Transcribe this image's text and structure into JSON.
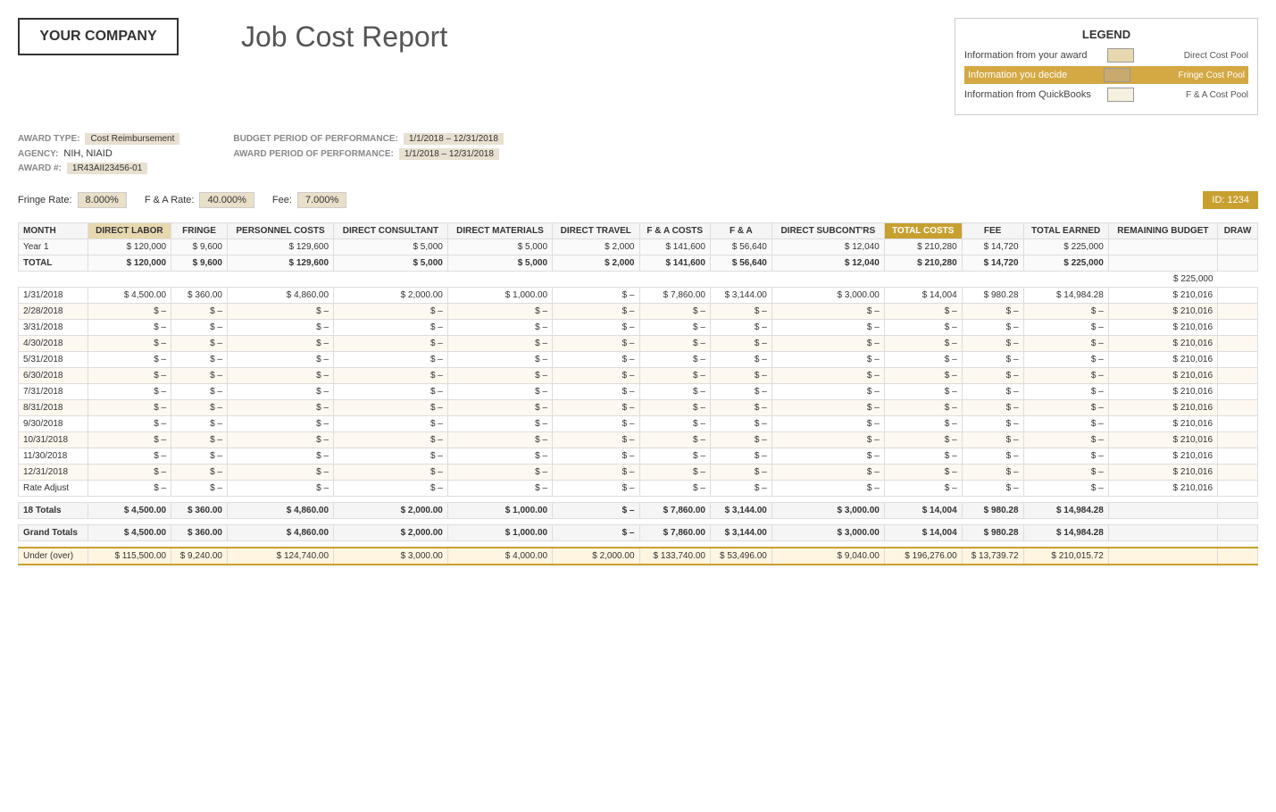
{
  "company": {
    "name": "YOUR COMPANY"
  },
  "title": "Job Cost Report",
  "legend": {
    "title": "LEGEND",
    "rows": [
      {
        "label": "Information from your award",
        "style": "plain",
        "swatch": "tan",
        "desc": "Direct Cost Pool"
      },
      {
        "label": "Information you decide",
        "style": "orange",
        "swatch": "orange",
        "desc": "Fringe Cost Pool"
      },
      {
        "label": "Information from QuickBooks",
        "style": "plain",
        "swatch": "light",
        "desc": "F & A Cost Pool"
      }
    ]
  },
  "award": {
    "type_label": "AWARD TYPE:",
    "type_value": "Cost Reimbursement",
    "agency_label": "AGENCY:",
    "agency_value": "NIH, NIAID",
    "number_label": "AWARD #:",
    "number_value": "1R43AII23456-01",
    "budget_label": "BUDGET PERIOD OF PERFORMANCE:",
    "budget_value": "1/1/2018 – 12/31/2018",
    "award_label": "AWARD PERIOD OF PERFORMANCE:",
    "award_value": "1/1/2018 – 12/31/2018"
  },
  "rates": {
    "fringe_label": "Fringe Rate:",
    "fringe_value": "8.000%",
    "fa_label": "F & A Rate:",
    "fa_value": "40.000%",
    "fee_label": "Fee:",
    "fee_value": "7.000%",
    "id_label": "ID:",
    "id_value": "1234"
  },
  "table": {
    "headers": [
      "MONTH",
      "DIRECT LABOR",
      "FRINGE",
      "PERSONNEL COSTS",
      "DIRECT CONSULTANT",
      "DIRECT MATERIALS",
      "DIRECT TRAVEL",
      "F & A COSTS",
      "F & A",
      "DIRECT SUBCONT'RS",
      "TOTAL COSTS",
      "FEE",
      "TOTAL EARNED",
      "REMAINING BUDGET",
      "DRAW"
    ],
    "year1_row": {
      "month": "Year 1",
      "direct_labor": "$ 120,000",
      "fringe": "$ 9,600",
      "personnel": "$ 129,600",
      "consultant": "$ 5,000",
      "materials": "$ 5,000",
      "travel": "$ 2,000",
      "fa_costs": "$ 141,600",
      "fa": "$ 56,640",
      "subcont": "$ 12,040",
      "total_costs": "$ 210,280",
      "fee": "$ 14,720",
      "total_earned": "$ 225,000",
      "remaining": "",
      "draw": ""
    },
    "total_row": {
      "month": "TOTAL",
      "direct_labor": "$ 120,000",
      "fringe": "$ 9,600",
      "personnel": "$ 129,600",
      "consultant": "$ 5,000",
      "materials": "$ 5,000",
      "travel": "$ 2,000",
      "fa_costs": "$ 141,600",
      "fa": "$ 56,640",
      "subcont": "$ 12,040",
      "total_costs": "$ 210,280",
      "fee": "$ 14,720",
      "total_earned": "$ 225,000",
      "remaining": "",
      "draw": ""
    },
    "spacer_225": "$ 225,000",
    "date_rows": [
      {
        "month": "1/31/2018",
        "direct_labor": "$ 4,500.00",
        "fringe": "$ 360.00",
        "personnel": "$ 4,860.00",
        "consultant": "$ 2,000.00",
        "materials": "$ 1,000.00",
        "travel": "$ –",
        "fa_costs": "$ 7,860.00",
        "fa": "$ 3,144.00",
        "subcont": "$ 3,000.00",
        "total_costs": "$ 14,004",
        "fee": "$ 980.28",
        "total_earned": "$ 14,984.28",
        "remaining": "$ 210,016",
        "draw": "",
        "alt": false
      },
      {
        "month": "2/28/2018",
        "direct_labor": "$ –",
        "fringe": "$ –",
        "personnel": "$ –",
        "consultant": "$ –",
        "materials": "$ –",
        "travel": "$ –",
        "fa_costs": "$ –",
        "fa": "$ –",
        "subcont": "$ –",
        "total_costs": "$ –",
        "fee": "$ –",
        "total_earned": "$ –",
        "remaining": "$ 210,016",
        "draw": "",
        "alt": true
      },
      {
        "month": "3/31/2018",
        "direct_labor": "$ –",
        "fringe": "$ –",
        "personnel": "$ –",
        "consultant": "$ –",
        "materials": "$ –",
        "travel": "$ –",
        "fa_costs": "$ –",
        "fa": "$ –",
        "subcont": "$ –",
        "total_costs": "$ –",
        "fee": "$ –",
        "total_earned": "$ –",
        "remaining": "$ 210,016",
        "draw": "",
        "alt": false
      },
      {
        "month": "4/30/2018",
        "direct_labor": "$ –",
        "fringe": "$ –",
        "personnel": "$ –",
        "consultant": "$ –",
        "materials": "$ –",
        "travel": "$ –",
        "fa_costs": "$ –",
        "fa": "$ –",
        "subcont": "$ –",
        "total_costs": "$ –",
        "fee": "$ –",
        "total_earned": "$ –",
        "remaining": "$ 210,016",
        "draw": "",
        "alt": true
      },
      {
        "month": "5/31/2018",
        "direct_labor": "$ –",
        "fringe": "$ –",
        "personnel": "$ –",
        "consultant": "$ –",
        "materials": "$ –",
        "travel": "$ –",
        "fa_costs": "$ –",
        "fa": "$ –",
        "subcont": "$ –",
        "total_costs": "$ –",
        "fee": "$ –",
        "total_earned": "$ –",
        "remaining": "$ 210,016",
        "draw": "",
        "alt": false
      },
      {
        "month": "6/30/2018",
        "direct_labor": "$ –",
        "fringe": "$ –",
        "personnel": "$ –",
        "consultant": "$ –",
        "materials": "$ –",
        "travel": "$ –",
        "fa_costs": "$ –",
        "fa": "$ –",
        "subcont": "$ –",
        "total_costs": "$ –",
        "fee": "$ –",
        "total_earned": "$ –",
        "remaining": "$ 210,016",
        "draw": "",
        "alt": true
      },
      {
        "month": "7/31/2018",
        "direct_labor": "$ –",
        "fringe": "$ –",
        "personnel": "$ –",
        "consultant": "$ –",
        "materials": "$ –",
        "travel": "$ –",
        "fa_costs": "$ –",
        "fa": "$ –",
        "subcont": "$ –",
        "total_costs": "$ –",
        "fee": "$ –",
        "total_earned": "$ –",
        "remaining": "$ 210,016",
        "draw": "",
        "alt": false
      },
      {
        "month": "8/31/2018",
        "direct_labor": "$ –",
        "fringe": "$ –",
        "personnel": "$ –",
        "consultant": "$ –",
        "materials": "$ –",
        "travel": "$ –",
        "fa_costs": "$ –",
        "fa": "$ –",
        "subcont": "$ –",
        "total_costs": "$ –",
        "fee": "$ –",
        "total_earned": "$ –",
        "remaining": "$ 210,016",
        "draw": "",
        "alt": true
      },
      {
        "month": "9/30/2018",
        "direct_labor": "$ –",
        "fringe": "$ –",
        "personnel": "$ –",
        "consultant": "$ –",
        "materials": "$ –",
        "travel": "$ –",
        "fa_costs": "$ –",
        "fa": "$ –",
        "subcont": "$ –",
        "total_costs": "$ –",
        "fee": "$ –",
        "total_earned": "$ –",
        "remaining": "$ 210,016",
        "draw": "",
        "alt": false
      },
      {
        "month": "10/31/2018",
        "direct_labor": "$ –",
        "fringe": "$ –",
        "personnel": "$ –",
        "consultant": "$ –",
        "materials": "$ –",
        "travel": "$ –",
        "fa_costs": "$ –",
        "fa": "$ –",
        "subcont": "$ –",
        "total_costs": "$ –",
        "fee": "$ –",
        "total_earned": "$ –",
        "remaining": "$ 210,016",
        "draw": "",
        "alt": true
      },
      {
        "month": "11/30/2018",
        "direct_labor": "$ –",
        "fringe": "$ –",
        "personnel": "$ –",
        "consultant": "$ –",
        "materials": "$ –",
        "travel": "$ –",
        "fa_costs": "$ –",
        "fa": "$ –",
        "subcont": "$ –",
        "total_costs": "$ –",
        "fee": "$ –",
        "total_earned": "$ –",
        "remaining": "$ 210,016",
        "draw": "",
        "alt": false
      },
      {
        "month": "12/31/2018",
        "direct_labor": "$ –",
        "fringe": "$ –",
        "personnel": "$ –",
        "consultant": "$ –",
        "materials": "$ –",
        "travel": "$ –",
        "fa_costs": "$ –",
        "fa": "$ –",
        "subcont": "$ –",
        "total_costs": "$ –",
        "fee": "$ –",
        "total_earned": "$ –",
        "remaining": "$ 210,016",
        "draw": "",
        "alt": true
      },
      {
        "month": "Rate Adjust",
        "direct_labor": "$ –",
        "fringe": "$ –",
        "personnel": "$ –",
        "consultant": "$ –",
        "materials": "$ –",
        "travel": "$ –",
        "fa_costs": "$ –",
        "fa": "$ –",
        "subcont": "$ –",
        "total_costs": "$ –",
        "fee": "$ –",
        "total_earned": "$ –",
        "remaining": "$ 210,016",
        "draw": "",
        "alt": false
      }
    ],
    "totals_18": {
      "month": "18 Totals",
      "direct_labor": "$ 4,500.00",
      "fringe": "$ 360.00",
      "personnel": "$ 4,860.00",
      "consultant": "$ 2,000.00",
      "materials": "$ 1,000.00",
      "travel": "$ –",
      "fa_costs": "$ 7,860.00",
      "fa": "$ 3,144.00",
      "subcont": "$ 3,000.00",
      "total_costs": "$ 14,004",
      "fee": "$ 980.28",
      "total_earned": "$ 14,984.28",
      "remaining": "",
      "draw": ""
    },
    "grand_totals": {
      "month": "Grand Totals",
      "direct_labor": "$ 4,500.00",
      "fringe": "$ 360.00",
      "personnel": "$ 4,860.00",
      "consultant": "$ 2,000.00",
      "materials": "$ 1,000.00",
      "travel": "$ –",
      "fa_costs": "$ 7,860.00",
      "fa": "$ 3,144.00",
      "subcont": "$ 3,000.00",
      "total_costs": "$ 14,004",
      "fee": "$ 980.28",
      "total_earned": "$ 14,984.28",
      "remaining": "",
      "draw": ""
    },
    "under_over": {
      "month": "Under (over)",
      "direct_labor": "$ 115,500.00",
      "fringe": "$ 9,240.00",
      "personnel": "$ 124,740.00",
      "consultant": "$ 3,000.00",
      "materials": "$ 4,000.00",
      "travel": "$ 2,000.00",
      "fa_costs": "$ 133,740.00",
      "fa": "$ 53,496.00",
      "subcont": "$ 9,040.00",
      "total_costs": "$ 196,276.00",
      "fee": "$ 13,739.72",
      "total_earned": "$ 210,015.72",
      "remaining": "",
      "draw": ""
    }
  }
}
